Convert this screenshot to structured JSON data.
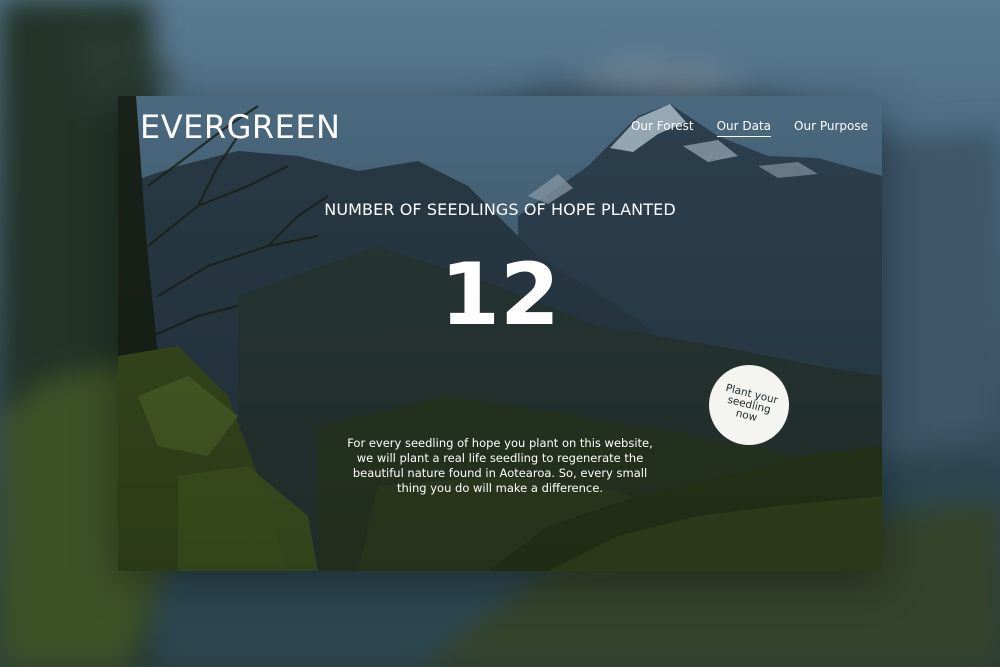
{
  "site": {
    "logo": "EVERGREEN"
  },
  "nav": {
    "items": [
      {
        "label": "Our Forest",
        "active": false
      },
      {
        "label": "Our Data",
        "active": true
      },
      {
        "label": "Our Purpose",
        "active": false
      }
    ]
  },
  "hero": {
    "headline": "NUMBER OF SEEDLINGS OF HOPE PLANTED",
    "count": "12",
    "description": "For every seedling of hope you plant on this website, we will plant a real life seedling to regenerate the beautiful nature found in Aotearoa. So, every small thing you do will make a difference.",
    "cta_label": "Plant your seedling now"
  },
  "colors": {
    "text": "#ffffff",
    "cta_background": "#f4f4f1",
    "cta_text": "#1e2a2c"
  }
}
